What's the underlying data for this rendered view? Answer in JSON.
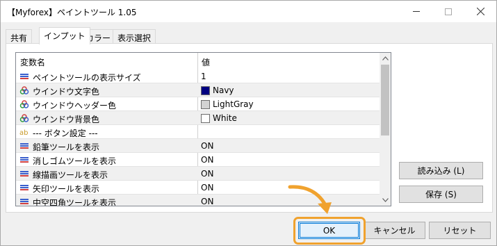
{
  "window": {
    "title": "【Myforex】ペイントツール 1.05"
  },
  "tabs": [
    {
      "label": "共有"
    },
    {
      "label": "インプット"
    },
    {
      "label": "カラー"
    },
    {
      "label": "表示選択"
    }
  ],
  "grid": {
    "col_name": "変数名",
    "col_value": "値",
    "rows": [
      {
        "name": "ペイントツールの表示サイズ",
        "value": "1",
        "icon": "int-icon"
      },
      {
        "name": "ウインドウ文字色",
        "value": "Navy",
        "icon": "color-icon",
        "swatch": "#000080"
      },
      {
        "name": "ウインドウヘッダー色",
        "value": "LightGray",
        "icon": "color-icon",
        "swatch": "#d3d3d3"
      },
      {
        "name": "ウインドウ背景色",
        "value": "White",
        "icon": "color-icon",
        "swatch": "#ffffff"
      },
      {
        "name": "--- ボタン設定 ---",
        "value": "",
        "icon": "string-icon"
      },
      {
        "name": "鉛筆ツールを表示",
        "value": "ON",
        "icon": "int-icon"
      },
      {
        "name": "消しゴムツールを表示",
        "value": "ON",
        "icon": "int-icon"
      },
      {
        "name": "線描画ツールを表示",
        "value": "ON",
        "icon": "int-icon"
      },
      {
        "name": "矢印ツールを表示",
        "value": "ON",
        "icon": "int-icon"
      },
      {
        "name": "中空四角ツールを表示",
        "value": "ON",
        "icon": "int-icon"
      }
    ]
  },
  "buttons": {
    "load": "読み込み (L)",
    "save": "保存 (S)",
    "ok": "OK",
    "cancel": "キャンセル",
    "reset": "リセット"
  },
  "colors": {
    "highlight": "#f0a22e",
    "focus": "#0078d7"
  }
}
